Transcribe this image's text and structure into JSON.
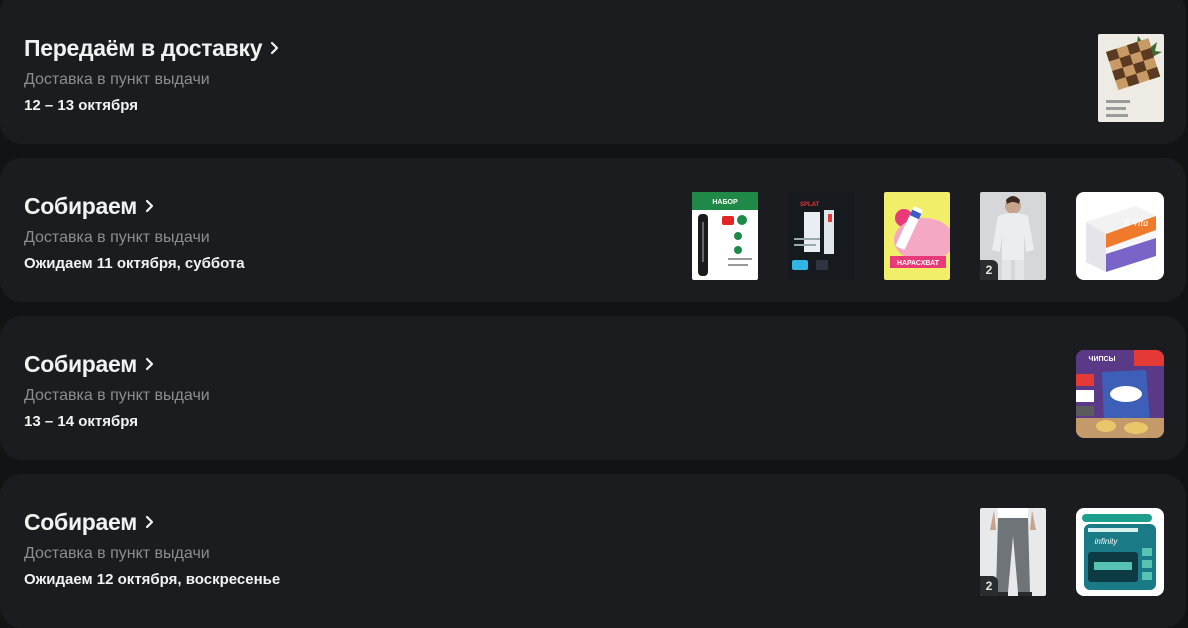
{
  "orders": [
    {
      "status": "Передаём в доставку",
      "delivery_type": "Доставка в пункт выдачи",
      "date": "12 – 13 октября",
      "products": [
        {
          "name": "chess-set-product",
          "count": ""
        }
      ]
    },
    {
      "status": "Собираем",
      "delivery_type": "Доставка в пункт выдачи",
      "date": "Ожидаем 11 октября, суббота",
      "products": [
        {
          "name": "nail-tool-set-product",
          "count": "",
          "label": "НАБОР"
        },
        {
          "name": "splat-toothpaste-product",
          "count": "",
          "label": "SPLAT"
        },
        {
          "name": "cream-tube-product",
          "count": "",
          "label": "НАРАСХВАТ"
        },
        {
          "name": "sweater-product",
          "count": "2"
        },
        {
          "name": "cotton-pads-product",
          "count": "",
          "label": "E Vita"
        }
      ]
    },
    {
      "status": "Собираем",
      "delivery_type": "Доставка в пункт выдачи",
      "date": "13 – 14 октября",
      "products": [
        {
          "name": "chips-product",
          "count": "",
          "label": "ЧИПСЫ"
        }
      ]
    },
    {
      "status": "Собираем",
      "delivery_type": "Доставка в пункт выдачи",
      "date": "Ожидаем 12 октября, воскресенье",
      "products": [
        {
          "name": "trousers-product",
          "count": "2"
        },
        {
          "name": "razor-cassettes-product",
          "count": "",
          "label": "infinity"
        }
      ]
    }
  ],
  "colors": {
    "background": "#121315",
    "card": "#1a1c1f",
    "text_primary": "#f2f2f3",
    "text_secondary": "#8b8d91"
  },
  "icons": {
    "chevron": "chevron-right-icon"
  }
}
